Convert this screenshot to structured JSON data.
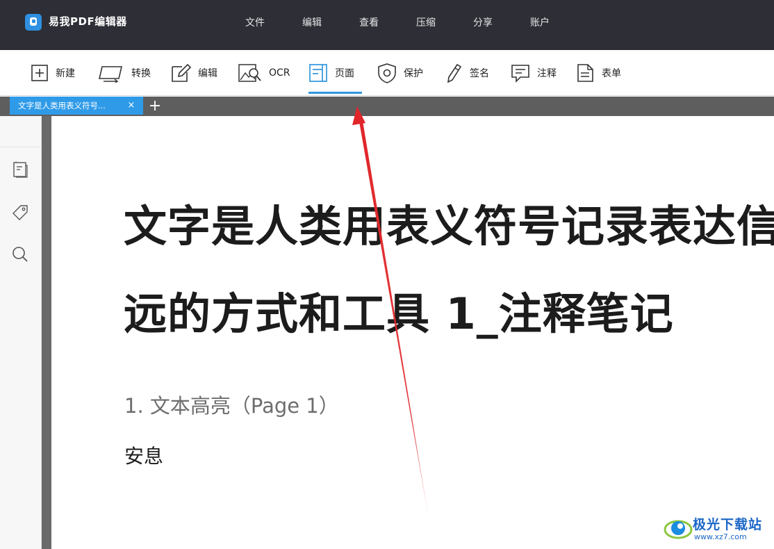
{
  "app": {
    "name": "易我PDF编辑器",
    "menu": [
      "文件",
      "编辑",
      "查看",
      "压缩",
      "分享",
      "账户"
    ]
  },
  "toolbar": {
    "items": [
      {
        "label": "新建",
        "icon": "plus-box-icon"
      },
      {
        "label": "转换",
        "icon": "convert-icon"
      },
      {
        "label": "编辑",
        "icon": "edit-icon"
      },
      {
        "label": "OCR",
        "icon": "ocr-image-search-icon"
      },
      {
        "label": "页面",
        "icon": "page-icon",
        "active": true
      },
      {
        "label": "保护",
        "icon": "shield-icon"
      },
      {
        "label": "签名",
        "icon": "pen-icon"
      },
      {
        "label": "注释",
        "icon": "comment-icon"
      },
      {
        "label": "表单",
        "icon": "form-icon"
      }
    ],
    "accent": "#2f96dd"
  },
  "tabs": {
    "active_tab": "文字是人类用表义符号...",
    "close": "×",
    "add": "+"
  },
  "sidebar": {
    "icons": [
      "pages-icon",
      "bookmark-tag-icon",
      "search-icon"
    ]
  },
  "document": {
    "title_line1": "文字是人类用表义符号记录表达信",
    "title_line2": "远的方式和工具 1_注释笔记",
    "heading": "1. 文本高亮（Page 1）",
    "body": "安息"
  },
  "annotation": {
    "arrow_color": "#e0262a",
    "icon": "red-arrow-pointer"
  },
  "watermark": {
    "name": "极光下载站",
    "url": "www.xz7.com"
  }
}
